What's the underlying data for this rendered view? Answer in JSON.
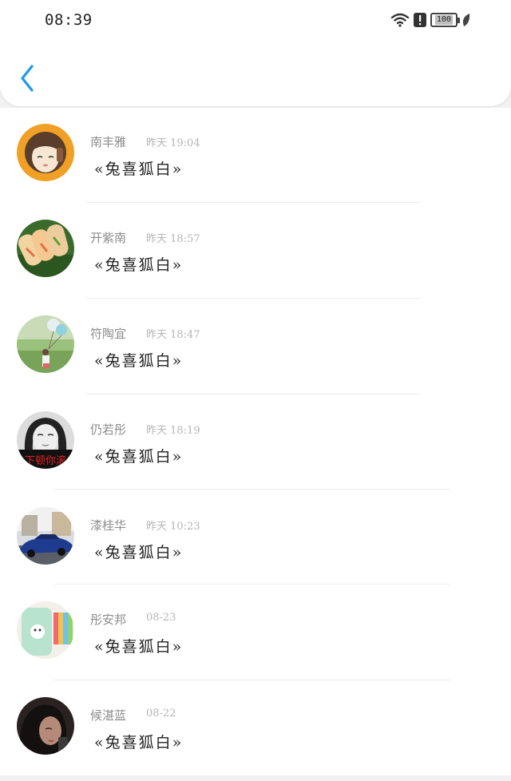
{
  "status_bar": {
    "time": "08:39",
    "battery": "100",
    "icons": [
      "wifi-icon",
      "alert-icon",
      "battery-icon",
      "leaf-icon"
    ]
  },
  "nav": {
    "back_icon": "chevron-left-icon"
  },
  "colors": {
    "accent": "#1e9be9",
    "name": "#8c8c8c",
    "timestamp": "#b5b5b5",
    "message": "#222222"
  },
  "messages": [
    {
      "name": "南丰雅",
      "time": "昨天 19:04",
      "text": "«兔喜狐白»",
      "avatar": "anime-girl-avatar"
    },
    {
      "name": "开紫南",
      "time": "昨天 18:57",
      "text": "«兔喜狐白»",
      "avatar": "spring-rolls-avatar"
    },
    {
      "name": "符陶宜",
      "time": "昨天 18:47",
      "text": "«兔喜狐白»",
      "avatar": "balloon-girl-avatar"
    },
    {
      "name": "仍若彤",
      "time": "昨天 18:19",
      "text": "«兔喜狐白»",
      "avatar": "bw-girl-avatar"
    },
    {
      "name": "漆桂华",
      "time": "昨天 10:23",
      "text": "«兔喜狐白»",
      "avatar": "blue-car-avatar"
    },
    {
      "name": "彤安邦",
      "time": "08-23",
      "text": "«兔喜狐白»",
      "avatar": "phone-case-avatar"
    },
    {
      "name": "候湛蓝",
      "time": "08-22",
      "text": "«兔喜狐白»",
      "avatar": "dark-girl-avatar"
    }
  ],
  "avatar_text": {
    "banner": "下顿你滚"
  }
}
